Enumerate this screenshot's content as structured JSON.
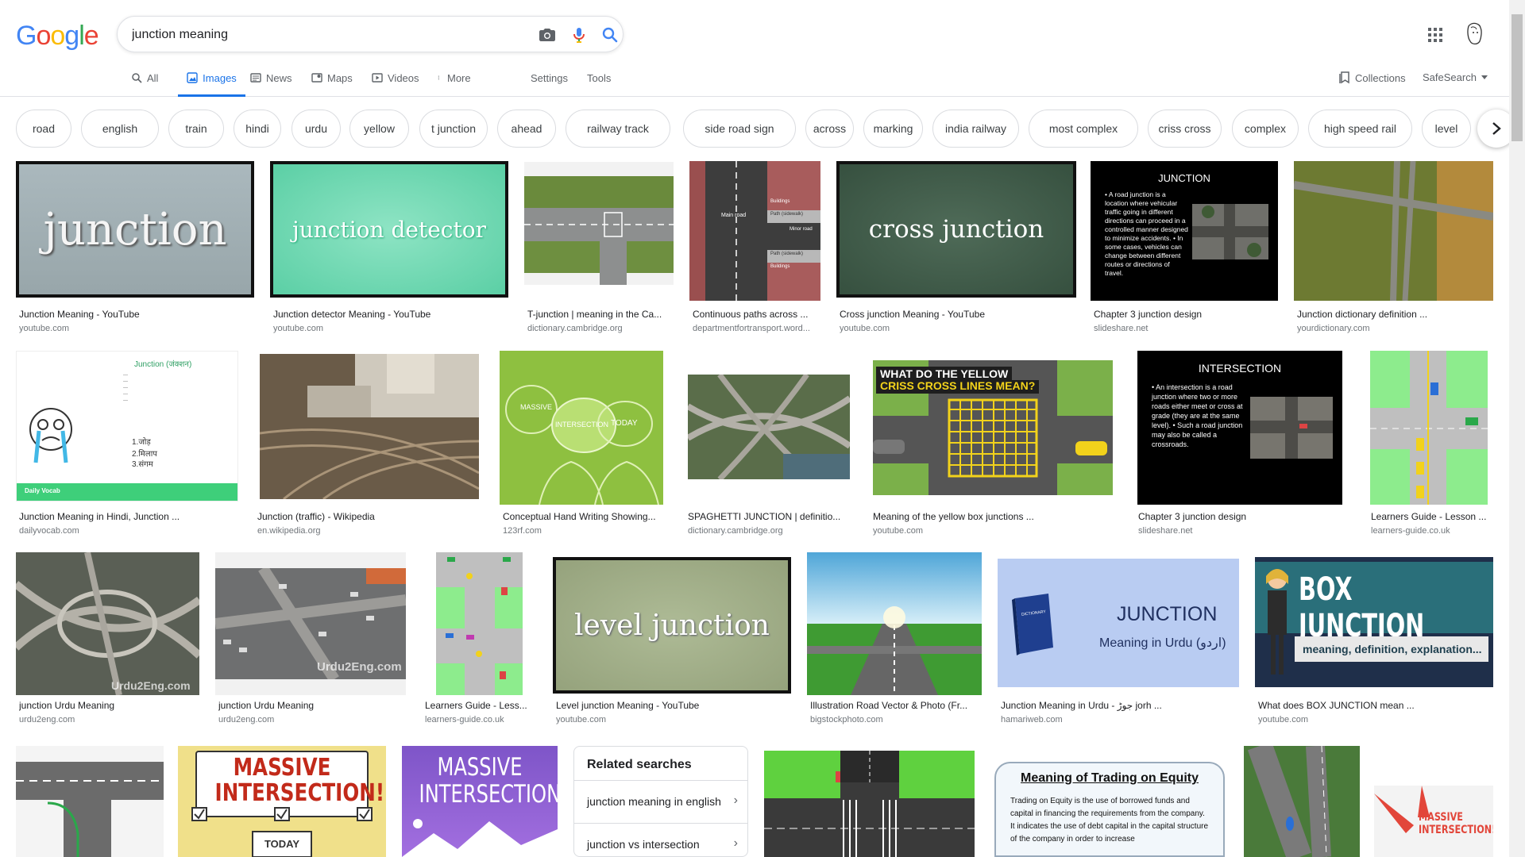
{
  "logo_letters": [
    {
      "ch": "G",
      "color": "#4285F4"
    },
    {
      "ch": "o",
      "color": "#EA4335"
    },
    {
      "ch": "o",
      "color": "#FBBC05"
    },
    {
      "ch": "g",
      "color": "#4285F4"
    },
    {
      "ch": "l",
      "color": "#34A853"
    },
    {
      "ch": "e",
      "color": "#EA4335"
    }
  ],
  "search": {
    "query": "junction meaning"
  },
  "tabs": {
    "all": "All",
    "images": "Images",
    "news": "News",
    "maps": "Maps",
    "videos": "Videos",
    "more": "More",
    "settings": "Settings",
    "tools": "Tools"
  },
  "right": {
    "collections": "Collections",
    "safesearch": "SafeSearch"
  },
  "chips": [
    "road",
    "english",
    "train",
    "hindi",
    "urdu",
    "yellow",
    "t junction",
    "ahead",
    "railway track",
    "side road sign",
    "across",
    "marking",
    "india railway",
    "most complex",
    "criss cross",
    "complex",
    "high speed rail",
    "level"
  ],
  "results": [
    {
      "caption": "Junction Meaning - YouTube",
      "source": "youtube.com",
      "board_text": "junction"
    },
    {
      "caption": "Junction detector Meaning - YouTube",
      "source": "youtube.com",
      "board_text": "junction detector"
    },
    {
      "caption": "T-junction | meaning in the Ca...",
      "source": "dictionary.cambridge.org"
    },
    {
      "caption": "Continuous paths across ...",
      "source": "departmentfortransport.word...",
      "labels": [
        "Main road",
        "Buildings",
        "Path (sidewalk)",
        "Minor road",
        "Path (sidewalk)",
        "Buildings"
      ]
    },
    {
      "caption": "Cross junction Meaning - YouTube",
      "source": "youtube.com",
      "board_text": "cross junction"
    },
    {
      "caption": "Chapter 3 junction design",
      "source": "slideshare.net",
      "slide_title": "JUNCTION",
      "slide_text": "• A road junction is a location where vehicular traffic going in different directions can proceed in a controlled manner designed to minimize accidents. • In some cases, vehicles can change between different routes or directions of travel."
    },
    {
      "caption": "Junction dictionary definition ...",
      "source": "yourdictionary.com"
    },
    {
      "caption": "Junction Meaning in Hindi, Junction ...",
      "source": "dailyvocab.com",
      "hindi_title": "Junction (जंक्शन)",
      "hindi_lines": [
        "1.जोड़",
        "2.मिलाप",
        "3.संगम"
      ],
      "brand": "Daily Vocab"
    },
    {
      "caption": "Junction (traffic) - Wikipedia",
      "source": "en.wikipedia.org"
    },
    {
      "caption": "Conceptual Hand Writing Showing...",
      "source": "123rf.com",
      "bubbles": [
        "MASSIVE",
        "INTERSECTION",
        "TODAY"
      ]
    },
    {
      "caption": "SPAGHETTI JUNCTION | definitio...",
      "source": "dictionary.cambridge.org"
    },
    {
      "caption": "Meaning of the yellow box junctions ...",
      "source": "youtube.com",
      "banner_1": "WHAT DO THE YELLOW",
      "banner_2": "CRISS CROSS LINES MEAN?"
    },
    {
      "caption": "Chapter 3 junction design",
      "source": "slideshare.net",
      "slide_title": "INTERSECTION",
      "slide_text": "• An intersection is a road junction where two or more roads either meet or cross at grade (they are at the same level). • Such a road junction may also be called a crossroads."
    },
    {
      "caption": "Learners Guide - Lesson ...",
      "source": "learners-guide.co.uk"
    },
    {
      "caption": "junction Urdu Meaning",
      "source": "urdu2eng.com",
      "watermark": "Urdu2Eng.com"
    },
    {
      "caption": "junction Urdu Meaning",
      "source": "urdu2eng.com",
      "watermark": "Urdu2Eng.com"
    },
    {
      "caption": "Learners Guide - Less...",
      "source": "learners-guide.co.uk"
    },
    {
      "caption": "Level junction Meaning - YouTube",
      "source": "youtube.com",
      "board_text": "level junction"
    },
    {
      "caption": "Illustration Road Vector & Photo (Fr...",
      "source": "bigstockphoto.com"
    },
    {
      "caption": "Junction Meaning in Urdu - جوڑ jorh ...",
      "source": "hamariweb.com",
      "title": "JUNCTION",
      "subtitle": "Meaning in Urdu (اردو)",
      "book": "DICTIONARY"
    },
    {
      "caption": "What does BOX JUNCTION mean ...",
      "source": "youtube.com",
      "title": "BOX JUNCTION",
      "subtitle": "meaning, definition, explanation..."
    }
  ],
  "bottom_row": {
    "massive_1": "MASSIVE INTERSECTION!",
    "massive_1_sign": "TODAY",
    "massive_2": "MASSIVE INTERSECTION!",
    "equity_title": "Meaning  of Trading on Equity",
    "equity_text": "Trading on Equity is the use of borrowed funds and capital in financing the requirements from the company. It indicates the use of debt capital in the capital structure of the company in order to increase",
    "massive_3": "MASSIVE INTERSECTION!"
  },
  "related": {
    "title": "Related searches",
    "items": [
      "junction meaning in english",
      "junction vs intersection"
    ]
  }
}
